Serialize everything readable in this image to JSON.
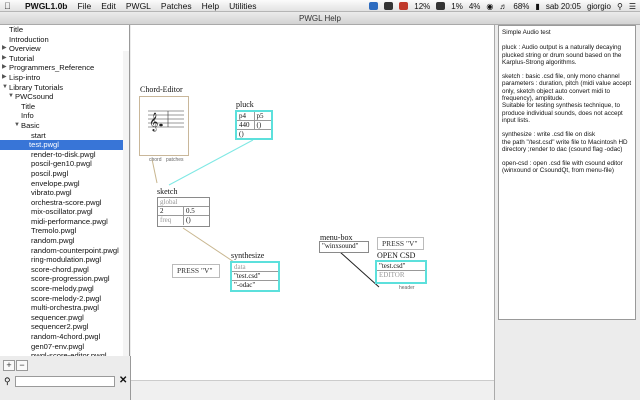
{
  "menubar": {
    "app_name": "PWGL1.0b",
    "items": [
      "File",
      "Edit",
      "PWGL",
      "Patches",
      "Help",
      "Utilities"
    ],
    "status": {
      "badge1": "12%",
      "badge2": "1%",
      "badge3": "4%",
      "battery": "68%",
      "clock": "sab 20:05",
      "user": "giorgio"
    }
  },
  "window": {
    "title": "PWGL Help"
  },
  "sidebar": {
    "items": [
      {
        "label": "Title",
        "indent": 0,
        "arrow": ""
      },
      {
        "label": "Introduction",
        "indent": 0,
        "arrow": ""
      },
      {
        "label": "Overview",
        "indent": 0,
        "arrow": "right"
      },
      {
        "label": "Tutorial",
        "indent": 0,
        "arrow": "right"
      },
      {
        "label": "Programmers_Reference",
        "indent": 0,
        "arrow": "right"
      },
      {
        "label": "Lisp-intro",
        "indent": 0,
        "arrow": "right"
      },
      {
        "label": "Library Tutorials",
        "indent": 0,
        "arrow": "down"
      },
      {
        "label": "PWCsound",
        "indent": 1,
        "arrow": "down"
      },
      {
        "label": "Title",
        "indent": 2,
        "arrow": ""
      },
      {
        "label": "Info",
        "indent": 2,
        "arrow": ""
      },
      {
        "label": "Basic",
        "indent": 2,
        "arrow": "down"
      },
      {
        "label": "start",
        "indent": 3,
        "arrow": ""
      },
      {
        "label": "test.pwgl",
        "indent": 3,
        "arrow": "",
        "selected": true
      },
      {
        "label": "render-to-disk.pwgl",
        "indent": 3,
        "arrow": ""
      },
      {
        "label": "poscil-gen10.pwgl",
        "indent": 3,
        "arrow": ""
      },
      {
        "label": "poscil.pwgl",
        "indent": 3,
        "arrow": ""
      },
      {
        "label": "envelope.pwgl",
        "indent": 3,
        "arrow": ""
      },
      {
        "label": "vibrato.pwgl",
        "indent": 3,
        "arrow": ""
      },
      {
        "label": "orchestra-score.pwgl",
        "indent": 3,
        "arrow": ""
      },
      {
        "label": "mix-oscillator.pwgl",
        "indent": 3,
        "arrow": ""
      },
      {
        "label": "midi-performance.pwgl",
        "indent": 3,
        "arrow": ""
      },
      {
        "label": "Tremolo.pwgl",
        "indent": 3,
        "arrow": ""
      },
      {
        "label": "random.pwgl",
        "indent": 3,
        "arrow": ""
      },
      {
        "label": "random-counterpoint.pwgl",
        "indent": 3,
        "arrow": ""
      },
      {
        "label": "ring-modulation.pwgl",
        "indent": 3,
        "arrow": ""
      },
      {
        "label": "score-chord.pwgl",
        "indent": 3,
        "arrow": ""
      },
      {
        "label": "score-progression.pwgl",
        "indent": 3,
        "arrow": ""
      },
      {
        "label": "score-melody.pwgl",
        "indent": 3,
        "arrow": ""
      },
      {
        "label": "score-melody-2.pwgl",
        "indent": 3,
        "arrow": ""
      },
      {
        "label": "multi-orchestra.pwgl",
        "indent": 3,
        "arrow": ""
      },
      {
        "label": "sequencer.pwgl",
        "indent": 3,
        "arrow": ""
      },
      {
        "label": "sequencer2.pwgl",
        "indent": 3,
        "arrow": ""
      },
      {
        "label": "random-4chord.pwgl",
        "indent": 3,
        "arrow": ""
      },
      {
        "label": "gen07-env.pwgl",
        "indent": 3,
        "arrow": ""
      },
      {
        "label": "pwgl-score-editor.pwgl",
        "indent": 3,
        "arrow": ""
      }
    ],
    "add_label": "+",
    "remove_label": "−",
    "search_value": ""
  },
  "patch": {
    "chord_editor": {
      "label": "Chord-Editor",
      "out1": "chord",
      "out2": "patches"
    },
    "pluck": {
      "label": "pluck",
      "row1": [
        "p4",
        "p5"
      ],
      "row2": [
        "440",
        "()"
      ],
      "row3": "()"
    },
    "sketch": {
      "label": "sketch",
      "row1": "global",
      "row2": [
        "2",
        "0.5"
      ],
      "row3": [
        "freq",
        "()"
      ]
    },
    "synthesize": {
      "label": "synthesize",
      "row1": "data",
      "row2": "\"test.csd\"",
      "row3": "\"-odac\""
    },
    "press1": "PRESS \"V\"",
    "menu_box": {
      "label": "menu-box",
      "value": "\"winxsound\""
    },
    "press2": "PRESS \"V\"",
    "open_csd": {
      "label": "OPEN CSD",
      "value": "\"test.csd\"",
      "sub": "EDITOR",
      "out": "header"
    }
  },
  "help": {
    "paragraphs": [
      "Simple Audio test",
      "pluck : Audio output is a naturally decaying plucked string or drum sound based on the Karplus-Strong algorithms.",
      "sketch : basic .csd file, only mono channel\nparameters : duration, pitch (midi value accept only, sketch object auto convert midi to frequency), amplitude.\nSuitable for testing synthesis technique, to produce individual sounds, does not accept input lists.",
      "synthesize : write .csd file on disk\nthe path \"/test.csd\" write file to Macintosh HD directory ;render to dac (csound flag -odac)",
      "open-csd : open .csd file with csound editor (winxound or CsoundQt, from menu-file)"
    ]
  },
  "colors": {
    "selection": "#3875d7",
    "cyan": "#5ce0dc",
    "wire_cyan": "#7fe8e4",
    "wire_tan": "#c8b68f"
  }
}
